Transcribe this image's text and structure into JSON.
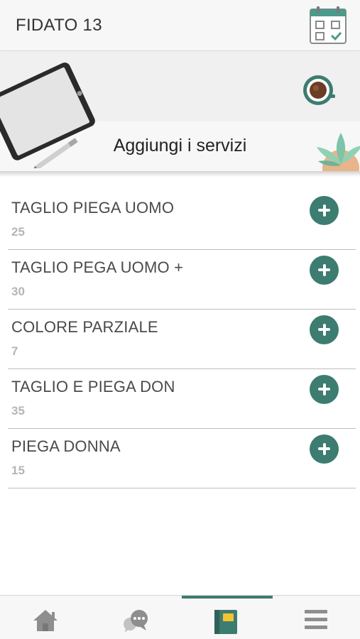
{
  "header": {
    "title": "FIDATO 13",
    "calendar_icon": "calendar-check-icon"
  },
  "banner": {
    "subtitle": "Aggiungi i servizi"
  },
  "services": [
    {
      "name": "TAGLIO PIEGA UOMO",
      "price": "25"
    },
    {
      "name": "TAGLIO PEGA UOMO +",
      "price": "30"
    },
    {
      "name": "COLORE PARZIALE",
      "price": "7"
    },
    {
      "name": "TAGLIO E PIEGA DON",
      "price": "35"
    },
    {
      "name": "PIEGA DONNA",
      "price": "15"
    }
  ],
  "nav": {
    "tabs": [
      {
        "icon": "home-icon"
      },
      {
        "icon": "chat-icon"
      },
      {
        "icon": "notebook-icon",
        "active": true
      },
      {
        "icon": "menu-icon"
      }
    ]
  },
  "colors": {
    "accent": "#3d7c70",
    "price_gray": "#b5b5b5"
  }
}
